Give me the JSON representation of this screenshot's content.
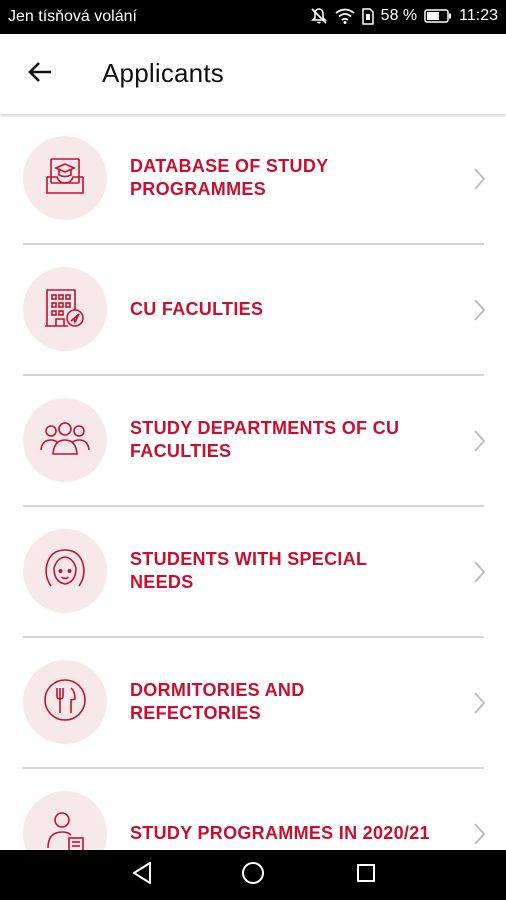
{
  "status_bar": {
    "carrier": "Jen tísňová volání",
    "battery": "58 %",
    "time": "11:23",
    "icons": [
      "mute-icon",
      "wifi-icon",
      "sim-icon",
      "battery-icon"
    ]
  },
  "header": {
    "title": "Applicants",
    "back_icon": "arrow-left-icon"
  },
  "menu": {
    "items": [
      {
        "label": "DATABASE OF STUDY PROGRAMMES",
        "icon": "graduation-tray-icon"
      },
      {
        "label": "CU FACULTIES",
        "icon": "faculty-building-icon"
      },
      {
        "label": "STUDY DEPARTMENTS OF CU FACULTIES",
        "icon": "people-group-icon"
      },
      {
        "label": "STUDENTS WITH SPECIAL NEEDS",
        "icon": "woman-face-icon"
      },
      {
        "label": "DORMITORIES AND REFECTORIES",
        "icon": "fork-knife-plate-icon"
      },
      {
        "label": "STUDY PROGRAMMES IN 2020/21",
        "icon": "person-document-icon"
      }
    ]
  },
  "nav_bar": {
    "buttons": [
      "back-triangle-icon",
      "home-circle-icon",
      "recents-square-icon"
    ]
  },
  "colors": {
    "accent": "#c8102e",
    "icon_circle": "#f7e9ea",
    "divider": "#d4d4d4",
    "status_bar": "#000000"
  }
}
